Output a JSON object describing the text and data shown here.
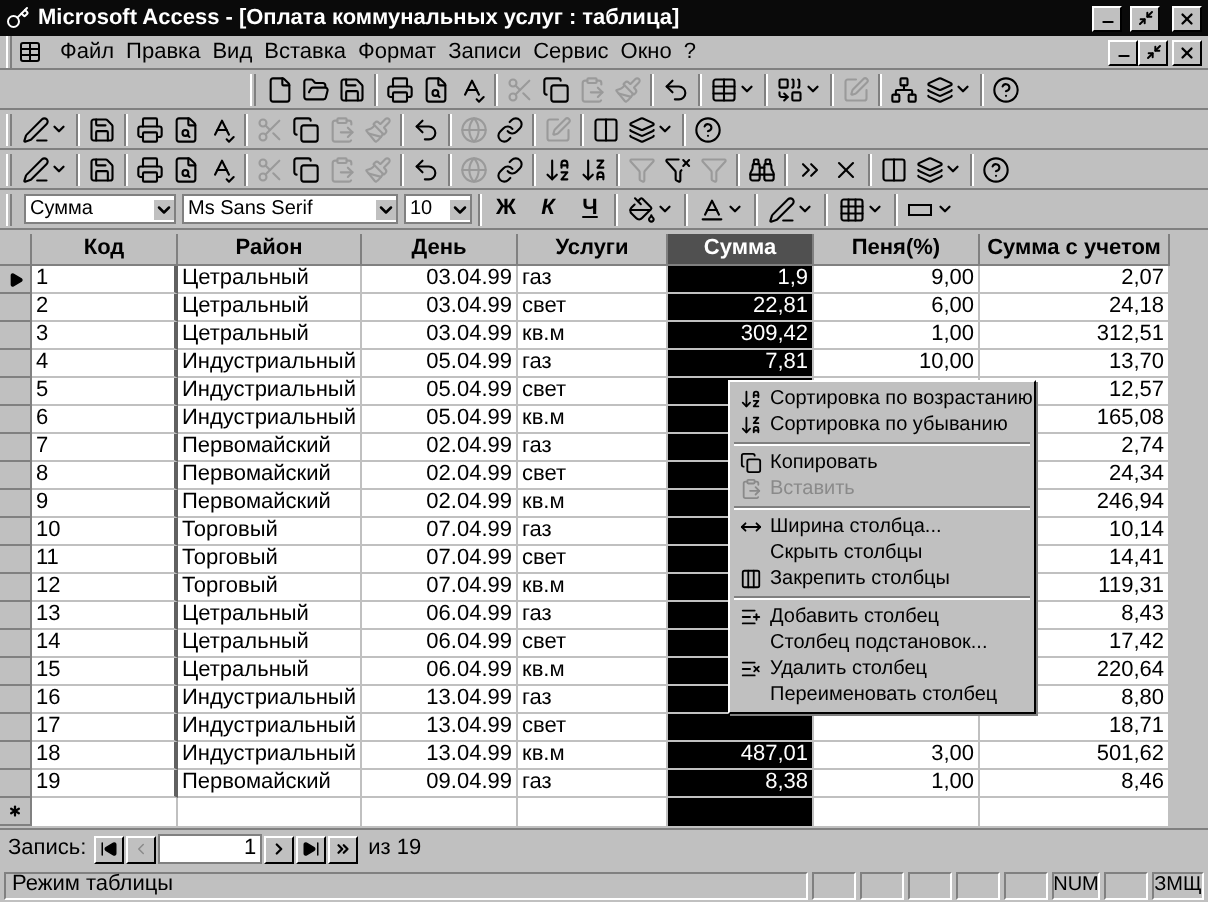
{
  "window": {
    "title": "Microsoft Access - [Оплата коммунальных услуг : таблица]"
  },
  "menu": [
    "Файл",
    "Правка",
    "Вид",
    "Вставка",
    "Формат",
    "Записи",
    "Сервис",
    "Окно",
    "?"
  ],
  "toolbars": [
    {
      "buttons": [
        {
          "kind": "new",
          "disabled": false
        },
        {
          "kind": "open",
          "disabled": false
        },
        {
          "kind": "save",
          "disabled": false
        },
        {
          "kind": "sep"
        },
        {
          "kind": "print",
          "disabled": false
        },
        {
          "kind": "preview",
          "disabled": false
        },
        {
          "kind": "spell",
          "disabled": false
        },
        {
          "kind": "sep"
        },
        {
          "kind": "cut",
          "disabled": true
        },
        {
          "kind": "copy",
          "disabled": false
        },
        {
          "kind": "paste",
          "disabled": true
        },
        {
          "kind": "painter",
          "disabled": true
        },
        {
          "kind": "sep"
        },
        {
          "kind": "undo",
          "disabled": false
        },
        {
          "kind": "sep"
        },
        {
          "kind": "view",
          "disabled": false
        },
        {
          "kind": "sep"
        },
        {
          "kind": "merge",
          "disabled": false
        },
        {
          "kind": "sep"
        },
        {
          "kind": "properties",
          "disabled": true
        },
        {
          "kind": "sep"
        },
        {
          "kind": "relations",
          "disabled": false
        },
        {
          "kind": "newobject",
          "disabled": false
        },
        {
          "kind": "sep"
        },
        {
          "kind": "help",
          "disabled": false
        }
      ]
    },
    {
      "buttons": [
        {
          "kind": "design",
          "disabled": false
        },
        {
          "kind": "sep"
        },
        {
          "kind": "save",
          "disabled": false
        },
        {
          "kind": "sep"
        },
        {
          "kind": "print",
          "disabled": false
        },
        {
          "kind": "preview",
          "disabled": false
        },
        {
          "kind": "spell",
          "disabled": false
        },
        {
          "kind": "sep"
        },
        {
          "kind": "cut",
          "disabled": true
        },
        {
          "kind": "copy",
          "disabled": false
        },
        {
          "kind": "paste",
          "disabled": true
        },
        {
          "kind": "painter",
          "disabled": true
        },
        {
          "kind": "sep"
        },
        {
          "kind": "undo",
          "disabled": false
        },
        {
          "kind": "sep"
        },
        {
          "kind": "web",
          "disabled": true
        },
        {
          "kind": "link",
          "disabled": false
        },
        {
          "kind": "sep"
        },
        {
          "kind": "properties",
          "disabled": true
        },
        {
          "kind": "sep"
        },
        {
          "kind": "window",
          "disabled": false
        },
        {
          "kind": "newobject",
          "disabled": false
        },
        {
          "kind": "sep"
        },
        {
          "kind": "help",
          "disabled": false
        }
      ]
    },
    {
      "buttons": [
        {
          "kind": "design",
          "disabled": false
        },
        {
          "kind": "sep"
        },
        {
          "kind": "save",
          "disabled": false
        },
        {
          "kind": "sep"
        },
        {
          "kind": "print",
          "disabled": false
        },
        {
          "kind": "preview",
          "disabled": false
        },
        {
          "kind": "spell",
          "disabled": false
        },
        {
          "kind": "sep"
        },
        {
          "kind": "cut",
          "disabled": true
        },
        {
          "kind": "copy",
          "disabled": false
        },
        {
          "kind": "paste",
          "disabled": true
        },
        {
          "kind": "painter",
          "disabled": true
        },
        {
          "kind": "sep"
        },
        {
          "kind": "undo",
          "disabled": false
        },
        {
          "kind": "sep"
        },
        {
          "kind": "web",
          "disabled": true
        },
        {
          "kind": "link",
          "disabled": false
        },
        {
          "kind": "sep"
        },
        {
          "kind": "sortasc",
          "disabled": false
        },
        {
          "kind": "sortdesc",
          "disabled": false
        },
        {
          "kind": "sep"
        },
        {
          "kind": "filtersel",
          "disabled": true
        },
        {
          "kind": "filterform",
          "disabled": false
        },
        {
          "kind": "filterapply",
          "disabled": true
        },
        {
          "kind": "sep"
        },
        {
          "kind": "find",
          "disabled": false
        },
        {
          "kind": "sep"
        },
        {
          "kind": "newrec",
          "disabled": false
        },
        {
          "kind": "delrec",
          "disabled": false
        },
        {
          "kind": "sep"
        },
        {
          "kind": "window",
          "disabled": false
        },
        {
          "kind": "newobject",
          "disabled": false
        },
        {
          "kind": "sep"
        },
        {
          "kind": "help",
          "disabled": false
        }
      ]
    }
  ],
  "formatting": {
    "field": "Сумма",
    "font": "Ms Sans Serif",
    "size": "10",
    "bold": "Ж",
    "italic": "К",
    "underline": "Ч"
  },
  "table": {
    "columns": [
      {
        "label": "Код",
        "selected": false
      },
      {
        "label": "Район",
        "selected": false
      },
      {
        "label": "День",
        "selected": false
      },
      {
        "label": "Услуги",
        "selected": false
      },
      {
        "label": "Сумма",
        "selected": true
      },
      {
        "label": "Пеня(%)",
        "selected": false
      },
      {
        "label": "Сумма с учетом",
        "selected": false
      }
    ],
    "rows": [
      {
        "current": true,
        "cells": [
          "1",
          "Цетральный",
          "03.04.99",
          "газ",
          "1,9",
          "9,00",
          "2,07"
        ]
      },
      {
        "current": false,
        "cells": [
          "2",
          "Цетральный",
          "03.04.99",
          "свет",
          "22,81",
          "6,00",
          "24,18"
        ]
      },
      {
        "current": false,
        "cells": [
          "3",
          "Цетральный",
          "03.04.99",
          "кв.м",
          "309,42",
          "1,00",
          "312,51"
        ]
      },
      {
        "current": false,
        "cells": [
          "4",
          "Индустриальный",
          "05.04.99",
          "газ",
          "7,81",
          "10,00",
          "13,70"
        ]
      },
      {
        "current": false,
        "cells": [
          "5",
          "Индустриальный",
          "05.04.99",
          "свет",
          null,
          null,
          "12,57"
        ]
      },
      {
        "current": false,
        "cells": [
          "6",
          "Индустриальный",
          "05.04.99",
          "кв.м",
          null,
          null,
          "165,08"
        ]
      },
      {
        "current": false,
        "cells": [
          "7",
          "Первомайский",
          "02.04.99",
          "газ",
          null,
          null,
          "2,74"
        ]
      },
      {
        "current": false,
        "cells": [
          "8",
          "Первомайский",
          "02.04.99",
          "свет",
          null,
          null,
          "24,34"
        ]
      },
      {
        "current": false,
        "cells": [
          "9",
          "Первомайский",
          "02.04.99",
          "кв.м",
          null,
          null,
          "246,94"
        ]
      },
      {
        "current": false,
        "cells": [
          "10",
          "Торговый",
          "07.04.99",
          "газ",
          null,
          null,
          "10,14"
        ]
      },
      {
        "current": false,
        "cells": [
          "11",
          "Торговый",
          "07.04.99",
          "свет",
          null,
          null,
          "14,41"
        ]
      },
      {
        "current": false,
        "cells": [
          "12",
          "Торговый",
          "07.04.99",
          "кв.м",
          null,
          null,
          "119,31"
        ]
      },
      {
        "current": false,
        "cells": [
          "13",
          "Цетральный",
          "06.04.99",
          "газ",
          null,
          null,
          "8,43"
        ]
      },
      {
        "current": false,
        "cells": [
          "14",
          "Цетральный",
          "06.04.99",
          "свет",
          null,
          null,
          "17,42"
        ]
      },
      {
        "current": false,
        "cells": [
          "15",
          "Цетральный",
          "06.04.99",
          "кв.м",
          null,
          null,
          "220,64"
        ]
      },
      {
        "current": false,
        "cells": [
          "16",
          "Индустриальный",
          "13.04.99",
          "газ",
          null,
          null,
          "8,80"
        ]
      },
      {
        "current": false,
        "cells": [
          "17",
          "Индустриальный",
          "13.04.99",
          "свет",
          null,
          null,
          "18,71"
        ]
      },
      {
        "current": false,
        "cells": [
          "18",
          "Индустриальный",
          "13.04.99",
          "кв.м",
          "487,01",
          "3,00",
          "501,62"
        ]
      },
      {
        "current": false,
        "cells": [
          "19",
          "Первомайский",
          "09.04.99",
          "газ",
          "8,38",
          "1,00",
          "8,46"
        ]
      }
    ]
  },
  "context_menu": [
    {
      "kind": "item",
      "label": "Сортировка по возрастанию",
      "disabled": false
    },
    {
      "kind": "item",
      "label": "Сортировка по убыванию",
      "disabled": false
    },
    {
      "kind": "separator"
    },
    {
      "kind": "item",
      "label": "Копировать",
      "disabled": false
    },
    {
      "kind": "item",
      "label": "Вставить",
      "disabled": true
    },
    {
      "kind": "separator"
    },
    {
      "kind": "item",
      "label": "Ширина столбца...",
      "disabled": false
    },
    {
      "kind": "item",
      "label": "Скрыть столбцы",
      "disabled": false
    },
    {
      "kind": "item",
      "label": "Закрепить столбцы",
      "disabled": false
    },
    {
      "kind": "separator"
    },
    {
      "kind": "item",
      "label": "Добавить столбец",
      "disabled": false
    },
    {
      "kind": "item",
      "label": "Столбец  подстановок...",
      "disabled": false
    },
    {
      "kind": "item",
      "label": "Удалить столбец",
      "disabled": false
    },
    {
      "kind": "item",
      "label": "Переименовать столбец",
      "disabled": false
    }
  ],
  "navigator": {
    "label": "Запись:",
    "record": "1",
    "total": "из 19"
  },
  "status_bar": {
    "text": "Режим таблицы",
    "num": "NUM",
    "overtype": "ЗМЩ"
  }
}
